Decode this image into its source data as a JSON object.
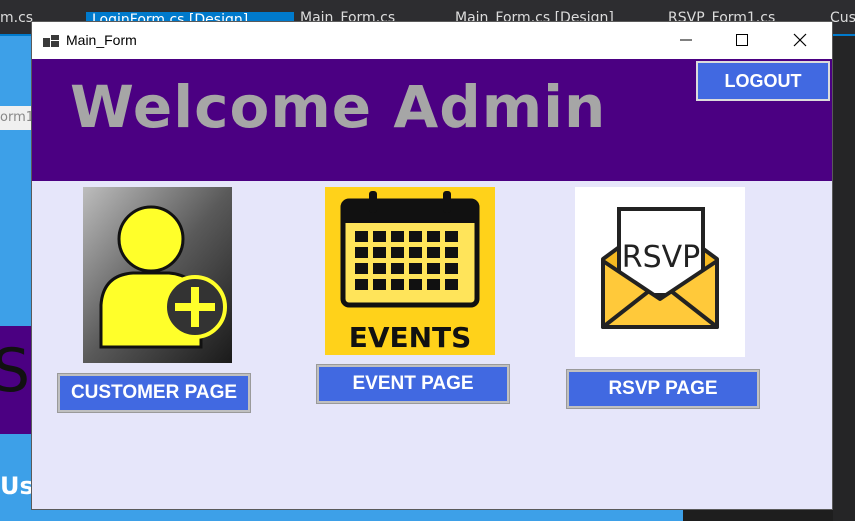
{
  "ide": {
    "tabs": [
      "m.cs",
      "LoginForm.cs [Design]",
      "Main_Form.cs",
      "Main_Form.cs [Design]",
      "RSVP_Form1.cs",
      "Cust"
    ],
    "designer_tab": "orm1",
    "left_big_text": "Si",
    "left_bottom_text": "Us"
  },
  "window": {
    "title": "Main_Form",
    "controls": {
      "minimize": "minimize-icon",
      "maximize": "maximize-icon",
      "close": "close-icon"
    }
  },
  "header": {
    "welcome": "Welcome Admin",
    "logout_label": "LOGOUT"
  },
  "tiles": {
    "customer": {
      "label": "CUSTOMER PAGE",
      "icon": "add-user-icon"
    },
    "event": {
      "label": "EVENT PAGE",
      "icon": "calendar-events-icon",
      "caption": "EVENTS"
    },
    "rsvp": {
      "label": "RSVP PAGE",
      "icon": "rsvp-envelope-icon",
      "caption": "RSVP"
    }
  },
  "colors": {
    "form_bg": "#e6e6fa",
    "header_bg": "#4b0082",
    "welcome_text": "#a6a6a6",
    "button_bg": "#4169e1",
    "button_text": "#ffffff"
  }
}
